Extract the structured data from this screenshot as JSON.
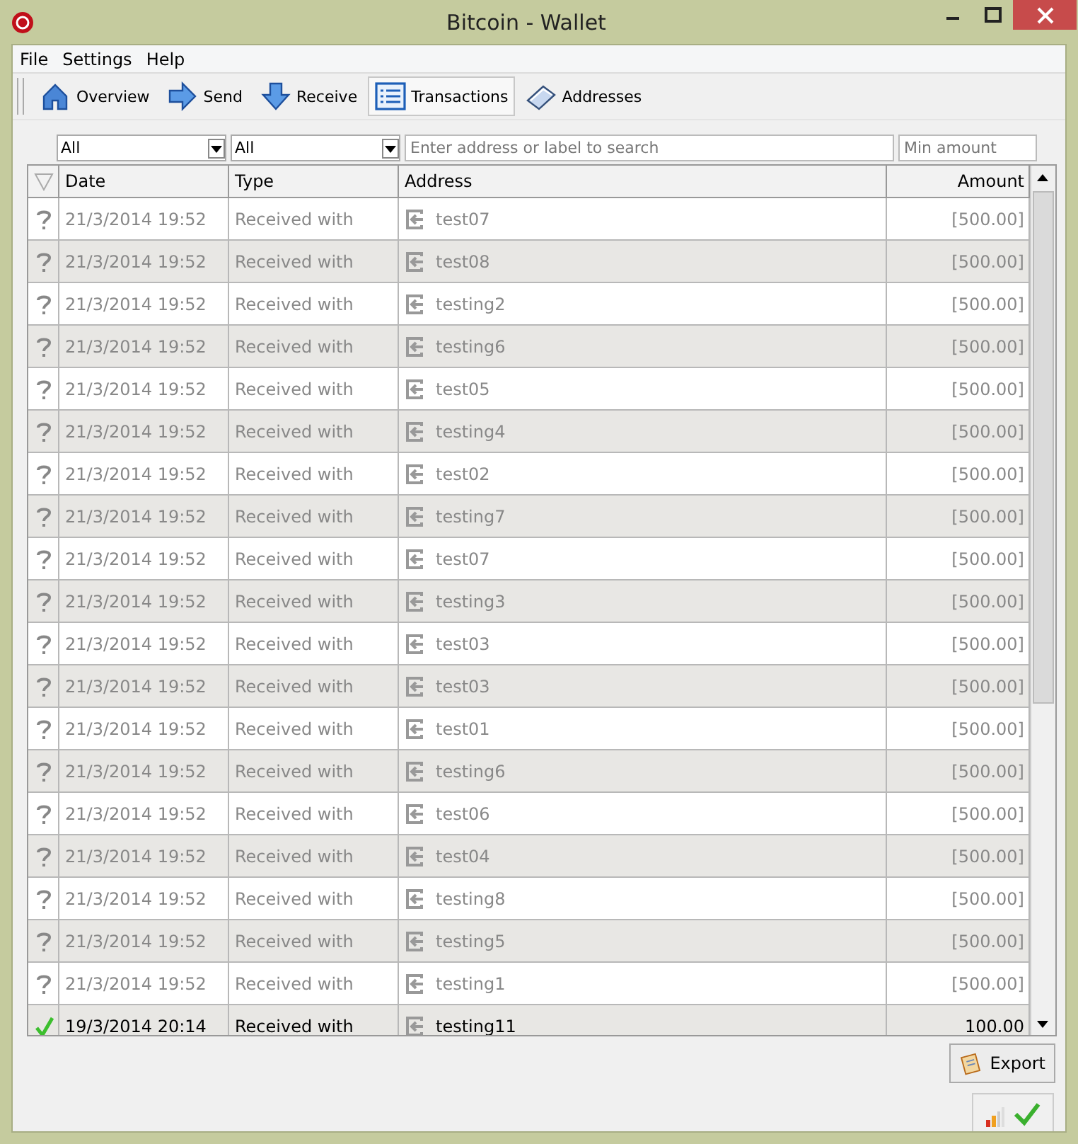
{
  "window": {
    "title": "Bitcoin - Wallet"
  },
  "menu": [
    "File",
    "Settings",
    "Help"
  ],
  "toolbar": [
    {
      "label": "Overview",
      "selected": false
    },
    {
      "label": "Send",
      "selected": false
    },
    {
      "label": "Receive",
      "selected": false
    },
    {
      "label": "Transactions",
      "selected": true
    },
    {
      "label": "Addresses",
      "selected": false
    }
  ],
  "filters": {
    "date": "All",
    "type": "All",
    "search_placeholder": "Enter address or label to search",
    "amount_placeholder": "Min amount"
  },
  "table": {
    "columns": [
      "Date",
      "Type",
      "Address",
      "Amount"
    ],
    "rows": [
      {
        "confirmed": false,
        "date": "21/3/2014 19:52",
        "type": "Received with",
        "address": "test07",
        "amount": "[500.00]"
      },
      {
        "confirmed": false,
        "date": "21/3/2014 19:52",
        "type": "Received with",
        "address": "test08",
        "amount": "[500.00]"
      },
      {
        "confirmed": false,
        "date": "21/3/2014 19:52",
        "type": "Received with",
        "address": "testing2",
        "amount": "[500.00]"
      },
      {
        "confirmed": false,
        "date": "21/3/2014 19:52",
        "type": "Received with",
        "address": "testing6",
        "amount": "[500.00]"
      },
      {
        "confirmed": false,
        "date": "21/3/2014 19:52",
        "type": "Received with",
        "address": "test05",
        "amount": "[500.00]"
      },
      {
        "confirmed": false,
        "date": "21/3/2014 19:52",
        "type": "Received with",
        "address": "testing4",
        "amount": "[500.00]"
      },
      {
        "confirmed": false,
        "date": "21/3/2014 19:52",
        "type": "Received with",
        "address": "test02",
        "amount": "[500.00]"
      },
      {
        "confirmed": false,
        "date": "21/3/2014 19:52",
        "type": "Received with",
        "address": "testing7",
        "amount": "[500.00]"
      },
      {
        "confirmed": false,
        "date": "21/3/2014 19:52",
        "type": "Received with",
        "address": "test07",
        "amount": "[500.00]"
      },
      {
        "confirmed": false,
        "date": "21/3/2014 19:52",
        "type": "Received with",
        "address": "testing3",
        "amount": "[500.00]"
      },
      {
        "confirmed": false,
        "date": "21/3/2014 19:52",
        "type": "Received with",
        "address": "test03",
        "amount": "[500.00]"
      },
      {
        "confirmed": false,
        "date": "21/3/2014 19:52",
        "type": "Received with",
        "address": "test03",
        "amount": "[500.00]"
      },
      {
        "confirmed": false,
        "date": "21/3/2014 19:52",
        "type": "Received with",
        "address": "test01",
        "amount": "[500.00]"
      },
      {
        "confirmed": false,
        "date": "21/3/2014 19:52",
        "type": "Received with",
        "address": "testing6",
        "amount": "[500.00]"
      },
      {
        "confirmed": false,
        "date": "21/3/2014 19:52",
        "type": "Received with",
        "address": "test06",
        "amount": "[500.00]"
      },
      {
        "confirmed": false,
        "date": "21/3/2014 19:52",
        "type": "Received with",
        "address": "test04",
        "amount": "[500.00]"
      },
      {
        "confirmed": false,
        "date": "21/3/2014 19:52",
        "type": "Received with",
        "address": "testing8",
        "amount": "[500.00]"
      },
      {
        "confirmed": false,
        "date": "21/3/2014 19:52",
        "type": "Received with",
        "address": "testing5",
        "amount": "[500.00]"
      },
      {
        "confirmed": false,
        "date": "21/3/2014 19:52",
        "type": "Received with",
        "address": "testing1",
        "amount": "[500.00]"
      },
      {
        "confirmed": true,
        "date": "19/3/2014 20:14",
        "type": "Received with",
        "address": "testing11",
        "amount": "100.00"
      }
    ]
  },
  "export_button": "Export"
}
